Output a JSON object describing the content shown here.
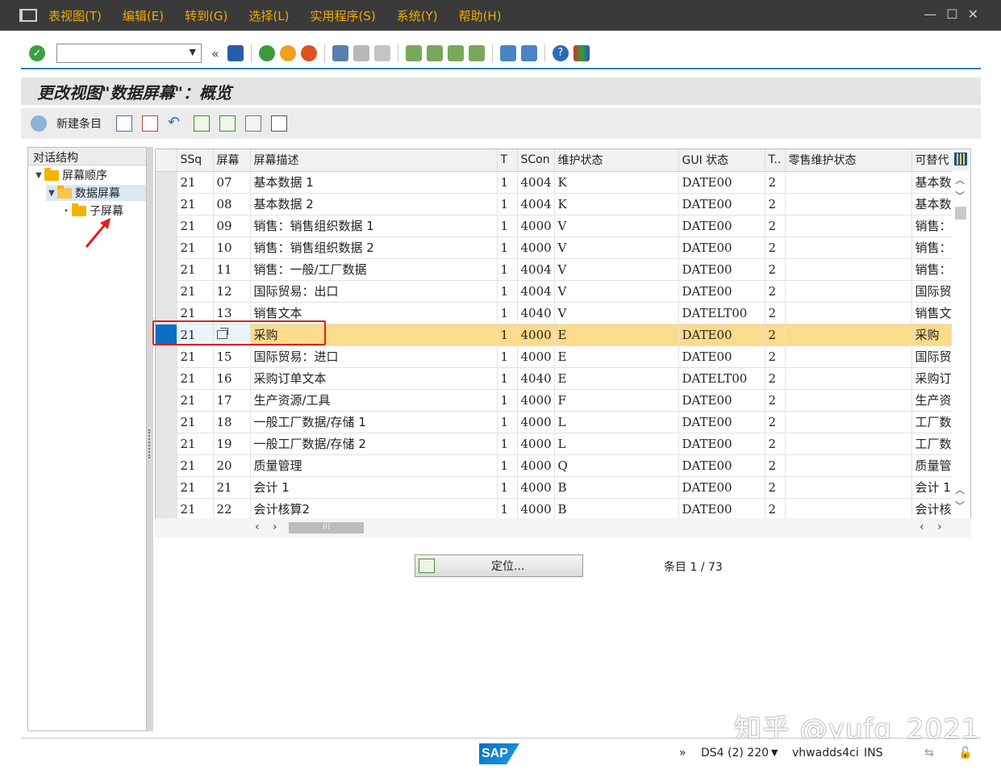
{
  "menu": {
    "items": [
      "表视图(T)",
      "编辑(E)",
      "转到(G)",
      "选择(L)",
      "实用程序(S)",
      "系统(Y)",
      "帮助(H)"
    ],
    "accent_color": "#f0ab00"
  },
  "toolbar": {
    "command_field_value": "",
    "icons": [
      "enter-icon",
      "save-icon",
      "back-icon",
      "exit-icon",
      "cancel-icon",
      "print-icon",
      "find-icon",
      "find-next-icon",
      "first-page-icon",
      "prev-page-icon",
      "next-page-icon",
      "last-page-icon",
      "new-session-icon",
      "shortcut-icon",
      "help-icon",
      "customize-layout-icon"
    ]
  },
  "page": {
    "title": "更改视图\"数据屏幕\"：概览"
  },
  "app_toolbar": {
    "new_entry_label": "新建条目"
  },
  "tree": {
    "header": "对话结构",
    "nodes": [
      {
        "label": "屏幕顺序",
        "level": 0,
        "expanded": true
      },
      {
        "label": "数据屏幕",
        "level": 1,
        "expanded": true,
        "selected": true
      },
      {
        "label": "子屏幕",
        "level": 2,
        "expanded": false
      }
    ]
  },
  "table": {
    "columns": [
      "SSq",
      "屏幕",
      "屏幕描述",
      "T",
      "SCon",
      "维护状态",
      "GUI 状态",
      "T..",
      "零售维护状态",
      "可替代"
    ],
    "rows": [
      [
        "21",
        "07",
        "基本数据 1",
        "1",
        "4004",
        "K",
        "DATE00",
        "2",
        "",
        "基本数"
      ],
      [
        "21",
        "08",
        "基本数据 2",
        "1",
        "4004",
        "K",
        "DATE00",
        "2",
        "",
        "基本数"
      ],
      [
        "21",
        "09",
        "销售：销售组织数据 1",
        "1",
        "4000",
        "V",
        "DATE00",
        "2",
        "",
        "销售：销"
      ],
      [
        "21",
        "10",
        "销售：销售组织数据 2",
        "1",
        "4000",
        "V",
        "DATE00",
        "2",
        "",
        "销售：销"
      ],
      [
        "21",
        "11",
        "销售：一般/工厂数据",
        "1",
        "4004",
        "V",
        "DATE00",
        "2",
        "",
        "销售："
      ],
      [
        "21",
        "12",
        "国际贸易：出口",
        "1",
        "4004",
        "V",
        "DATE00",
        "2",
        "",
        "国际贸"
      ],
      [
        "21",
        "13",
        "销售文本",
        "1",
        "4040",
        "V",
        "DATELT00",
        "2",
        "",
        "销售文"
      ],
      [
        "21",
        "",
        "采购",
        "1",
        "4000",
        "E",
        "DATE00",
        "2",
        "",
        "采购"
      ],
      [
        "21",
        "15",
        "国际贸易：进口",
        "1",
        "4000",
        "E",
        "DATE00",
        "2",
        "",
        "国际贸"
      ],
      [
        "21",
        "16",
        "采购订单文本",
        "1",
        "4040",
        "E",
        "DATELT00",
        "2",
        "",
        "采购订"
      ],
      [
        "21",
        "17",
        "生产资源/工具",
        "1",
        "4000",
        "F",
        "DATE00",
        "2",
        "",
        "生产资"
      ],
      [
        "21",
        "18",
        "一般工厂数据/存储 1",
        "1",
        "4000",
        "L",
        "DATE00",
        "2",
        "",
        "工厂数"
      ],
      [
        "21",
        "19",
        "一般工厂数据/存储 2",
        "1",
        "4000",
        "L",
        "DATE00",
        "2",
        "",
        "工厂数"
      ],
      [
        "21",
        "20",
        "质量管理",
        "1",
        "4000",
        "Q",
        "DATE00",
        "2",
        "",
        "质量管"
      ],
      [
        "21",
        "21",
        "会计 1",
        "1",
        "4000",
        "B",
        "DATE00",
        "2",
        "",
        "会计 1"
      ],
      [
        "21",
        "22",
        "会计核算2",
        "1",
        "4000",
        "B",
        "DATE00",
        "2",
        "",
        "会计核"
      ]
    ],
    "highlight_row_index": 7,
    "highlight_color": "#fcdb8c"
  },
  "footer": {
    "locate_label": "定位...",
    "entry_count": "条目 1 / 73"
  },
  "status": {
    "system": "DS4 (2) 220",
    "server": "vhwadds4ci",
    "mode": "INS",
    "logo": "SAP",
    "more": "»"
  },
  "watermark": "知乎 @yufq_2021"
}
